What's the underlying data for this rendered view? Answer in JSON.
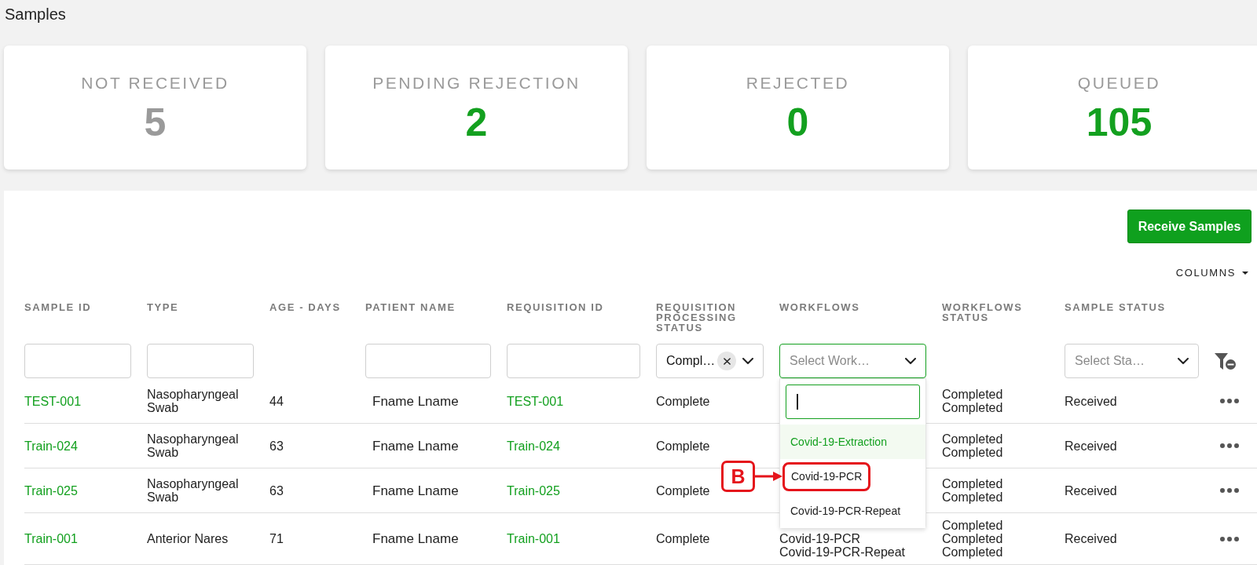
{
  "page": {
    "title": "Samples"
  },
  "summary_cards": [
    {
      "label": "NOT RECEIVED",
      "value": "5",
      "color": "#9a9a9a"
    },
    {
      "label": "PENDING REJECTION",
      "value": "2",
      "color": "#13a01f"
    },
    {
      "label": "REJECTED",
      "value": "0",
      "color": "#13a01f"
    },
    {
      "label": "QUEUED",
      "value": "105",
      "color": "#13a01f"
    }
  ],
  "toolbar": {
    "primary_button": "Receive Samples",
    "columns_menu": "COLUMNS"
  },
  "table": {
    "columns": [
      {
        "label": "SAMPLE ID",
        "filter": {
          "kind": "text"
        }
      },
      {
        "label": "TYPE",
        "filter": {
          "kind": "text"
        }
      },
      {
        "label": "AGE - DAYS"
      },
      {
        "label": "PATIENT NAME",
        "filter": {
          "kind": "text"
        }
      },
      {
        "label": "REQUISITION ID",
        "filter": {
          "kind": "text"
        }
      },
      {
        "label": "REQUISITION PROCESSING STATUS",
        "filter": {
          "kind": "select",
          "value": "Compl…",
          "clearable": true,
          "focused": false
        }
      },
      {
        "label": "WORKFLOWS",
        "filter": {
          "kind": "select",
          "placeholder": "Select Work…",
          "focused": true,
          "expanded": true,
          "menu": {
            "search_field": {
              "focused": true
            },
            "options": [
              {
                "label": "Covid-19-Extraction",
                "active": true
              },
              {
                "label": "Covid-19-PCR",
                "active": false,
                "callout": "B"
              },
              {
                "label": "Covid-19-PCR-Repeat",
                "active": false
              }
            ]
          }
        }
      },
      {
        "label": "WORKFLOWS STATUS"
      },
      {
        "label": "SAMPLE STATUS",
        "filter": {
          "kind": "select",
          "placeholder": "Select Sta…",
          "focused": false
        }
      }
    ],
    "rows": [
      {
        "sample_id": "TEST-001",
        "type": "Nasopharyngeal Swab",
        "age_days": "44",
        "patient_name": "Fname Lname",
        "requisition_id": "TEST-001",
        "processing_status": "Complete",
        "workflows_status": [
          "Completed",
          "Completed"
        ],
        "sample_status": "Received"
      },
      {
        "sample_id": "Train-024",
        "type": "Nasopharyngeal Swab",
        "age_days": "63",
        "patient_name": "Fname Lname",
        "requisition_id": "Train-024",
        "processing_status": "Complete",
        "workflows_status": [
          "Completed",
          "Completed"
        ],
        "sample_status": "Received"
      },
      {
        "sample_id": "Train-025",
        "type": "Nasopharyngeal Swab",
        "age_days": "63",
        "patient_name": "Fname Lname",
        "requisition_id": "Train-025",
        "processing_status": "Complete",
        "workflows_status": [
          "Completed",
          "Completed"
        ],
        "sample_status": "Received"
      },
      {
        "sample_id": "Train-001",
        "type": "Anterior Nares",
        "age_days": "71",
        "patient_name": "Fname Lname",
        "requisition_id": "Train-001",
        "processing_status": "Complete",
        "workflows": [
          "Covid-19-PCR",
          "Covid-19-PCR-Repeat"
        ],
        "workflows_status": [
          "Completed",
          "Completed",
          "Completed"
        ],
        "sample_status": "Received"
      }
    ]
  }
}
